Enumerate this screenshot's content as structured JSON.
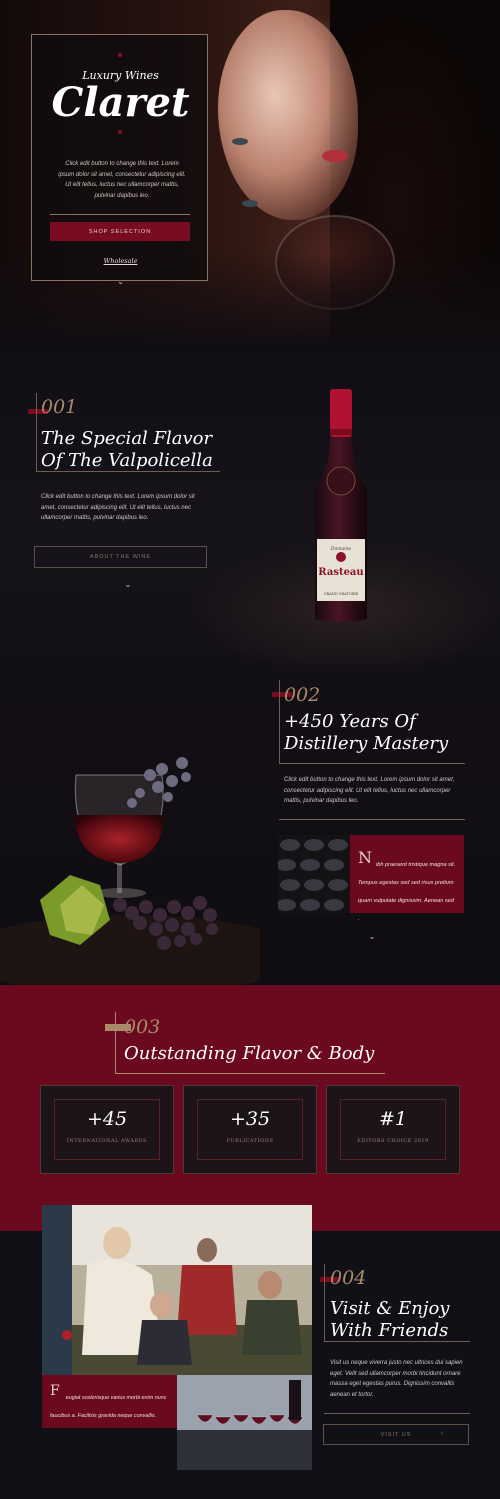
{
  "hero": {
    "subtitle": "Luxury Wines",
    "title": "Claret",
    "text": "Click edit button to change this text. Lorem ipsum dolor sit amet, consectetur adipiscing elit. Ut elit tellus, luctus nec ullamcorper mattis, pulvinar dapibus leo.",
    "button": "SHOP SELECTION",
    "link": "Wholesale",
    "chevron": "⌄"
  },
  "section1": {
    "number": "001",
    "heading_line1": "The Special Flavor",
    "heading_line2": "Of The Valpolicella",
    "text": "Click edit button to change this text. Lorem ipsum dolor sit amet, consectetur adipiscing elit. Ut elit tellus, luctus nec ullamcorper mattis, pulvinar dapibus leo.",
    "button": "ABOUT THE WINE",
    "chevron": "⌄",
    "bottle_brand": "Domaine",
    "bottle_name": "Rasteau",
    "bottle_sub": "GRAND ORATOIRE"
  },
  "section2": {
    "number": "002",
    "heading_line1": "+450 Years Of",
    "heading_line2": "Distillery Mastery",
    "text": "Click edit button to change this text. Lorem ipsum dolor sit amet, consectetur adipiscing elit. Ut elit tellus, luctus nec ullamcorper mattis, pulvinar dapibus leo.",
    "dropcap": "N",
    "box_text": "ibh praesent tristique magna sit. Tempus egestas sed sed risus pretium quam vulputate dignissim. Aenean sed .",
    "chevron": "⌄"
  },
  "section3": {
    "number": "003",
    "heading": "Outstanding Flavor & Body",
    "stats": [
      {
        "value": "+45",
        "label": "INTERNATIONAL AWARDS"
      },
      {
        "value": "+35",
        "label": "PUBLICATIONS"
      },
      {
        "value": "#1",
        "label": "EDITORS CHOICE 2019"
      }
    ]
  },
  "section4": {
    "number": "004",
    "heading_line1": "Visit & Enjoy",
    "heading_line2": "With Friends",
    "text": "Visit us neque viverra justo nec ultrices dui sapien eget. Velit sed ullamcorper morbi tincidunt ornare massa eget egestas purus. Dignissim convallis aenean et tortor.",
    "dropcap": "F",
    "box_text": "eugiat scelerisque varius morbi enim nunc faucibus a. Facilisis gravida neque convallis.",
    "button": "VISIT US",
    "arrow": "›"
  },
  "colors": {
    "accent": "#7a0c22",
    "gold": "#a88a6a",
    "bg": "#121017"
  }
}
